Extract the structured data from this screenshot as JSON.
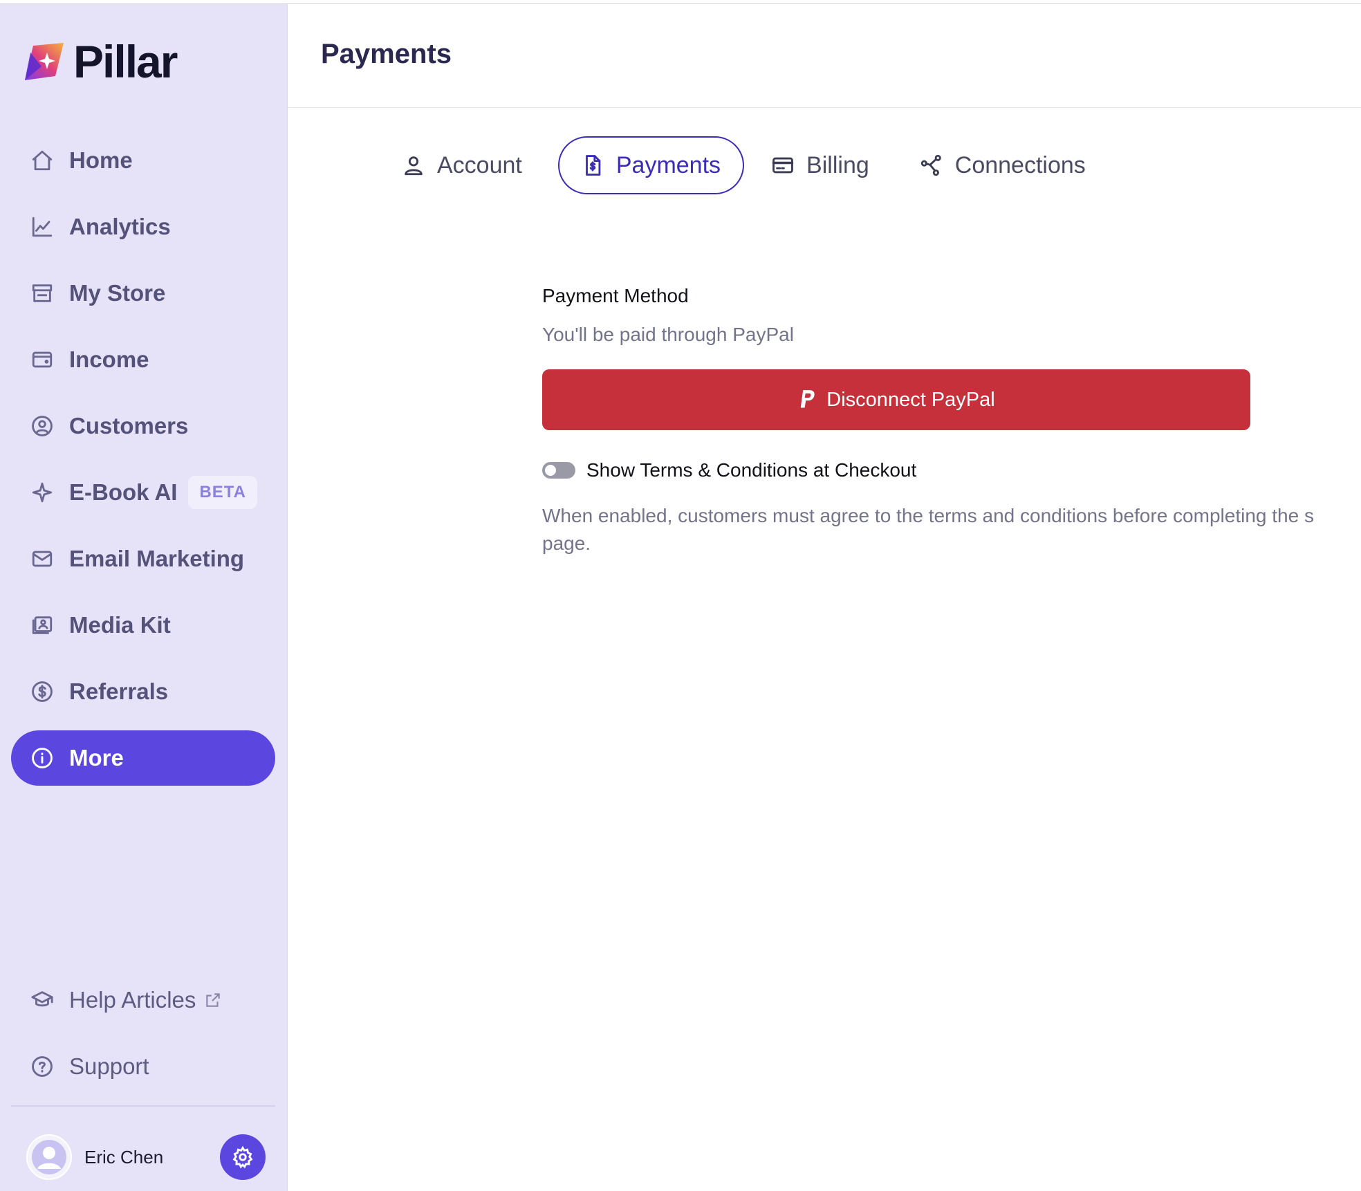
{
  "app": {
    "name": "Pillar"
  },
  "sidebar": {
    "items": [
      {
        "label": "Home",
        "icon": "home-icon"
      },
      {
        "label": "Analytics",
        "icon": "chart-icon"
      },
      {
        "label": "My Store",
        "icon": "store-icon"
      },
      {
        "label": "Income",
        "icon": "wallet-icon"
      },
      {
        "label": "Customers",
        "icon": "user-circle-icon"
      },
      {
        "label": "E-Book AI",
        "icon": "sparkle-icon",
        "badge": "BETA"
      },
      {
        "label": "Email Marketing",
        "icon": "mail-icon"
      },
      {
        "label": "Media Kit",
        "icon": "media-kit-icon"
      },
      {
        "label": "Referrals",
        "icon": "dollar-circle-icon"
      },
      {
        "label": "More",
        "icon": "info-circle-icon",
        "active": true
      }
    ],
    "bottom_items": [
      {
        "label": "Help Articles",
        "icon": "graduation-cap-icon",
        "external": true
      },
      {
        "label": "Support",
        "icon": "question-circle-icon"
      }
    ],
    "user": {
      "name": "Eric Chen"
    }
  },
  "header": {
    "title": "Payments"
  },
  "tabs": [
    {
      "label": "Account",
      "icon": "user-icon",
      "active": false
    },
    {
      "label": "Payments",
      "icon": "invoice-icon",
      "active": true
    },
    {
      "label": "Billing",
      "icon": "credit-card-icon",
      "active": false
    },
    {
      "label": "Connections",
      "icon": "share-nodes-icon",
      "active": false
    }
  ],
  "payment": {
    "section_title": "Payment Method",
    "subtitle": "You'll be paid through PayPal",
    "disconnect_label": "Disconnect PayPal",
    "toggle_label": "Show Terms & Conditions at Checkout",
    "toggle_on": false,
    "help_text": "When enabled, customers must agree to the terms and conditions before completing the s page."
  },
  "colors": {
    "accent": "#5b47e0",
    "danger": "#c5303b",
    "sidebar_bg": "#e6e2f7",
    "tab_active": "#3b2db8"
  }
}
